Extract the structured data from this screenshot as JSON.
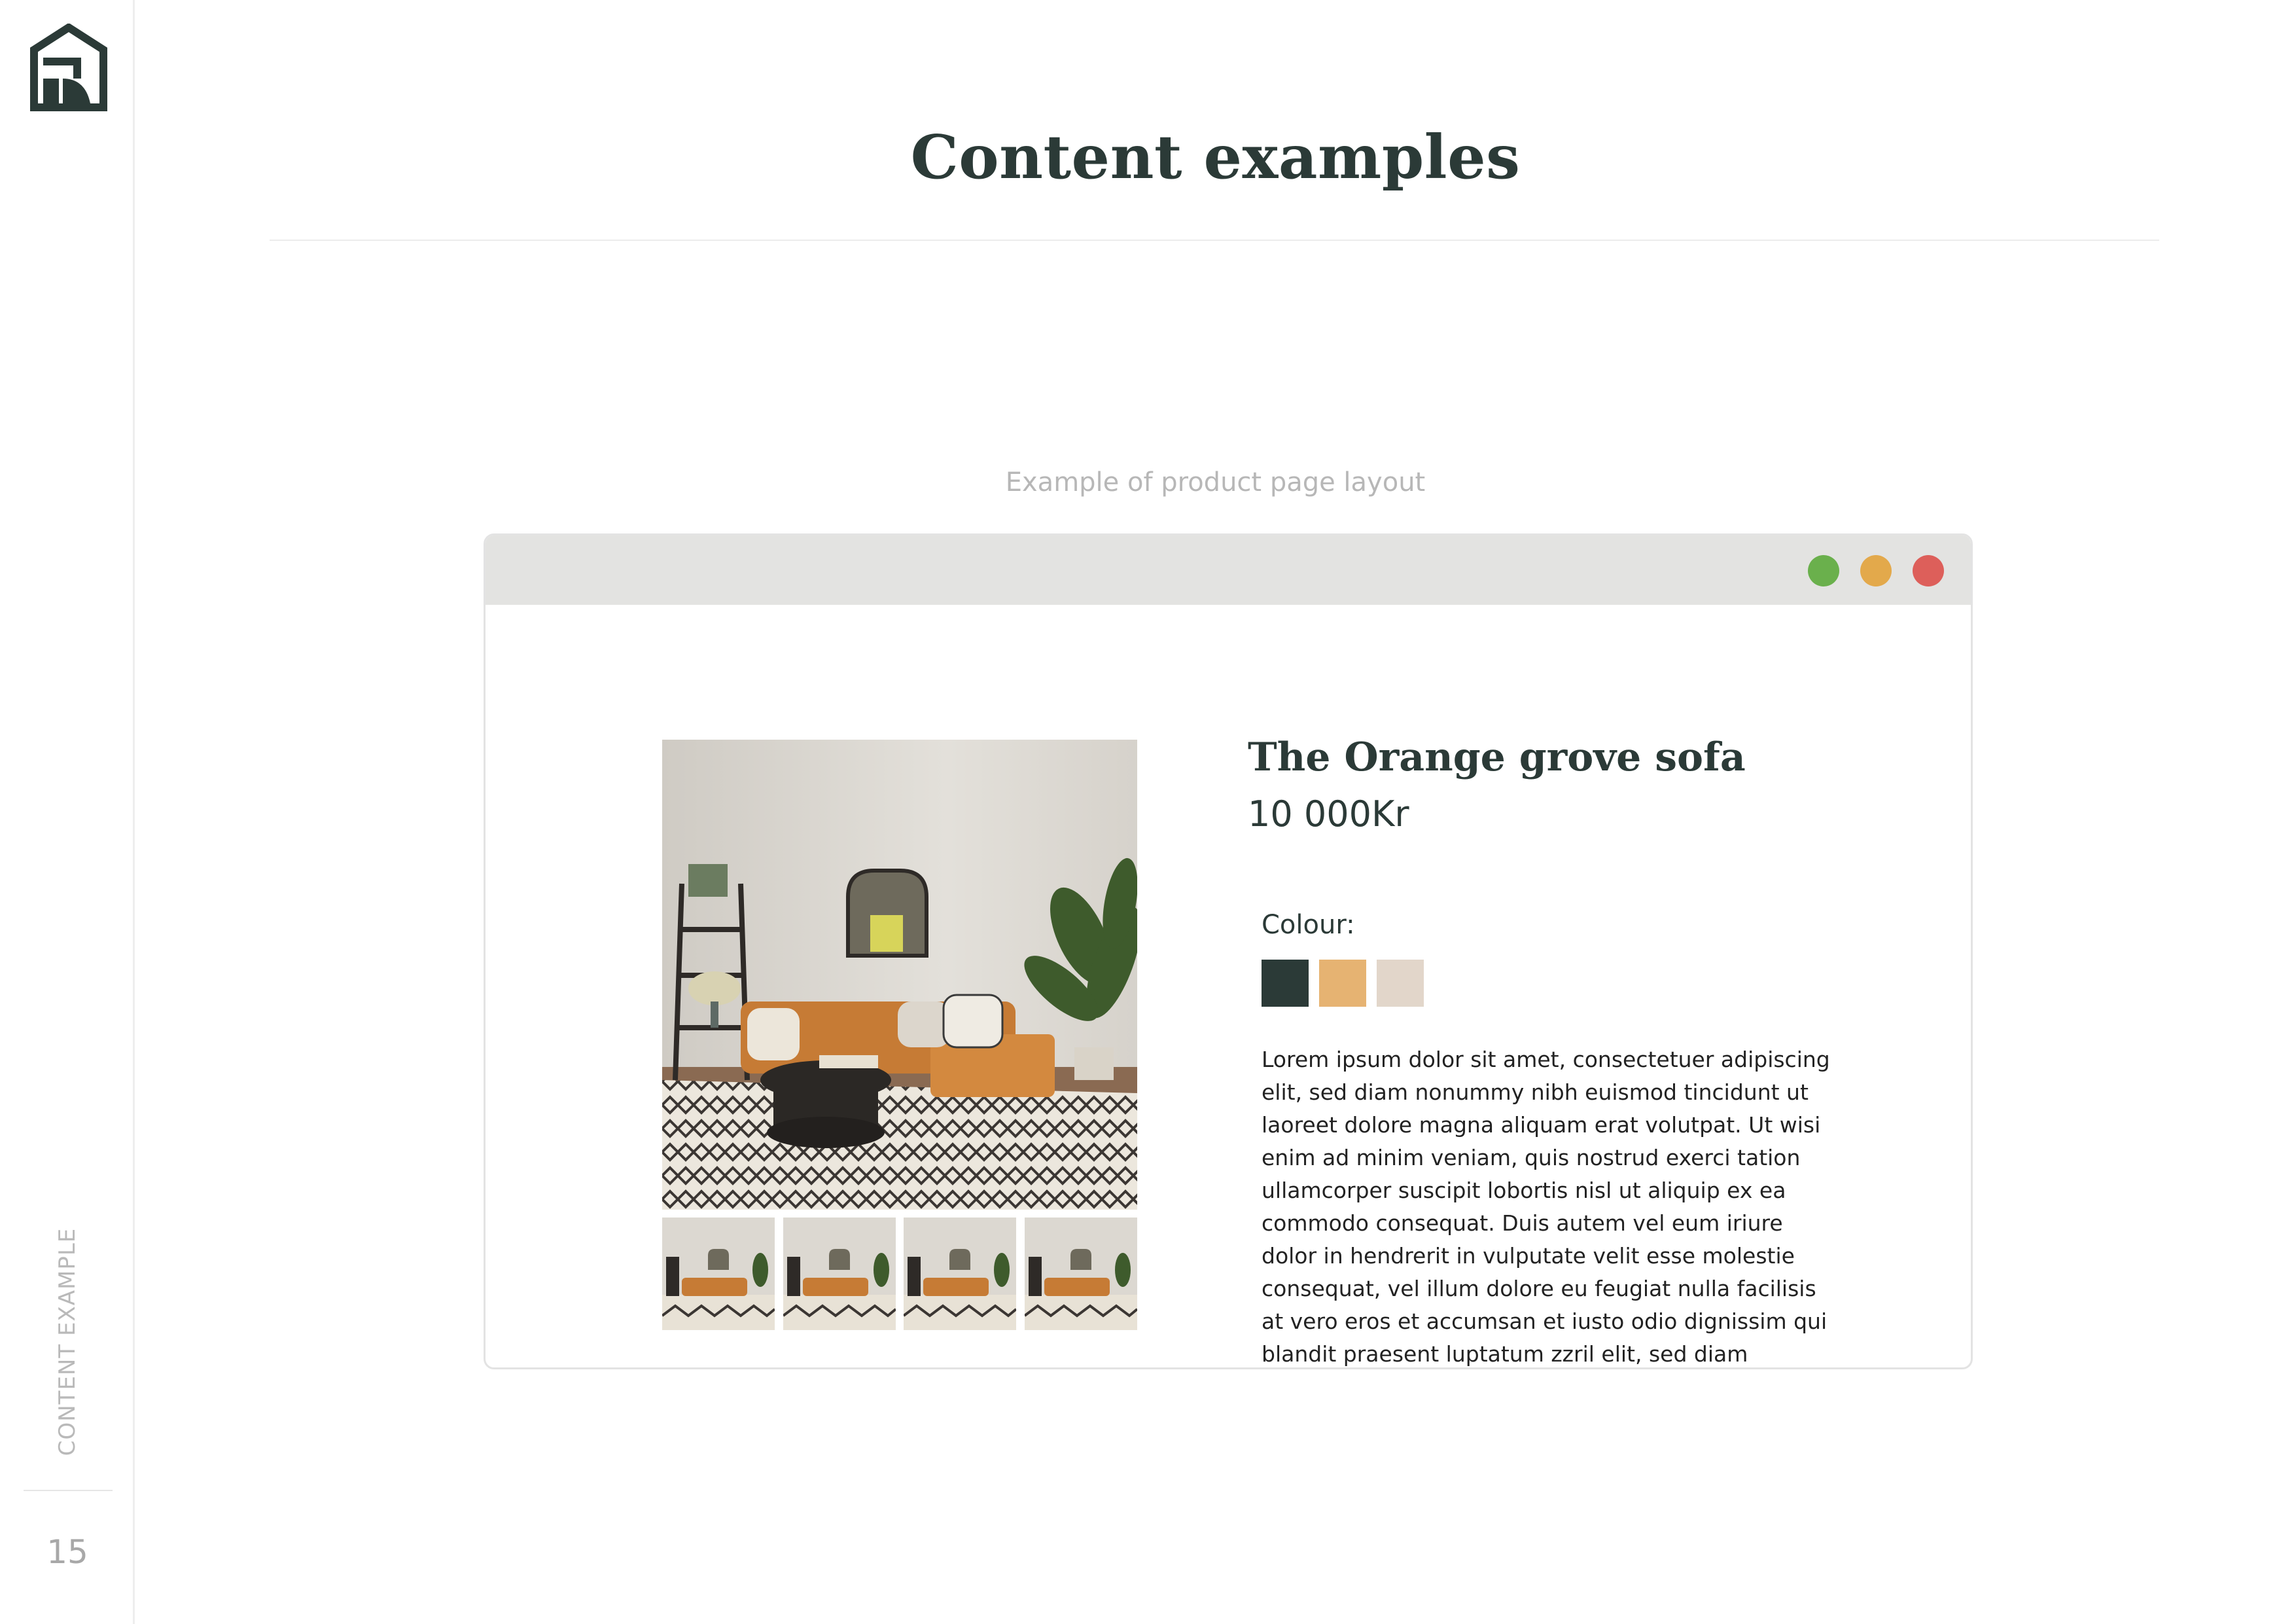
{
  "sidebar": {
    "logo_icon": "house-logo-icon",
    "section_label": "CONTENT EXAMPLE",
    "page_number": "15"
  },
  "header": {
    "title": "Content examples"
  },
  "caption": "Example of product page layout",
  "browser": {
    "window_buttons": [
      {
        "name": "green",
        "color": "#6ab04c"
      },
      {
        "name": "orange",
        "color": "#e3a94b"
      },
      {
        "name": "red",
        "color": "#dd5f5a"
      }
    ],
    "product": {
      "title": "The Orange grove sofa",
      "price": "10 000Kr",
      "colour_label": "Colour:",
      "colour_options": [
        "#2b3a37",
        "#e6b372",
        "#e2d6ca"
      ],
      "description_lines": [
        "Lorem ipsum dolor sit amet, consectetuer adipiscing",
        "elit, sed diam nonummy nibh euismod tincidunt ut",
        "laoreet dolore magna aliquam erat volutpat. Ut wisi",
        "enim ad minim veniam, quis nostrud exerci tation",
        "ullamcorper suscipit lobortis nisl ut aliquip ex ea",
        "commodo consequat. Duis autem vel eum iriure",
        "dolor in hendrerit in vulputate velit esse molestie",
        "consequat, vel illum dolore eu feugiat nulla facilisis",
        "at vero eros et accumsan et iusto odio dignissim qui",
        "blandit praesent luptatum zzril  elit, sed diam"
      ]
    }
  },
  "colors": {
    "brand_dark": "#2b3a37",
    "muted_text": "#b7b7b7"
  }
}
